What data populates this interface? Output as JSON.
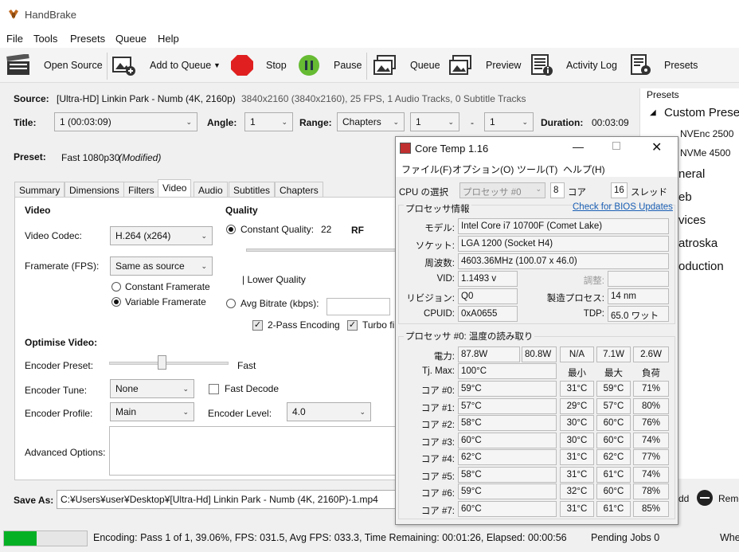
{
  "app": {
    "title": "HandBrake"
  },
  "menu": [
    "File",
    "Tools",
    "Presets",
    "Queue",
    "Help"
  ],
  "toolbar": {
    "open_source": "Open Source",
    "add_to_queue": "Add to Queue",
    "stop": "Stop",
    "pause": "Pause",
    "queue": "Queue",
    "preview": "Preview",
    "activity_log": "Activity Log",
    "presets": "Presets"
  },
  "source": {
    "label": "Source:",
    "name": "[Ultra-HD] Linkin Park - Numb (4K, 2160p)",
    "info": "3840x2160 (3840x2160), 25 FPS, 1 Audio Tracks, 0 Subtitle Tracks"
  },
  "title_row": {
    "title_label": "Title:",
    "title_value": "1 (00:03:09)",
    "angle_label": "Angle:",
    "angle_value": "1",
    "range_label": "Range:",
    "range_type": "Chapters",
    "range_start": "1",
    "range_sep": "-",
    "range_end": "1",
    "duration_label": "Duration:",
    "duration_value": "00:03:09"
  },
  "preset": {
    "label": "Preset:",
    "value": "Fast 1080p30",
    "modified": "(Modified)"
  },
  "tabs": [
    "Summary",
    "Dimensions",
    "Filters",
    "Video",
    "Audio",
    "Subtitles",
    "Chapters"
  ],
  "video": {
    "heading": "Video",
    "codec_label": "Video Codec:",
    "codec_value": "H.264 (x264)",
    "framerate_label": "Framerate (FPS):",
    "framerate_value": "Same as source",
    "constant_fr": "Constant Framerate",
    "variable_fr": "Variable Framerate"
  },
  "quality": {
    "heading": "Quality",
    "constant_quality": "Constant Quality:",
    "cq_value": "22",
    "rf": "RF",
    "lower_quality": "| Lower Quality",
    "avg_bitrate": "Avg Bitrate (kbps):",
    "two_pass": "2-Pass Encoding",
    "turbo": "Turbo fir"
  },
  "optimise": {
    "heading": "Optimise Video:",
    "preset_label": "Encoder Preset:",
    "preset_value": "Fast",
    "tune_label": "Encoder Tune:",
    "tune_value": "None",
    "fast_decode": "Fast Decode",
    "profile_label": "Encoder Profile:",
    "profile_value": "Main",
    "level_label": "Encoder Level:",
    "level_value": "4.0",
    "advanced_label": "Advanced Options:"
  },
  "save": {
    "label": "Save As:",
    "path": "C:¥Users¥user¥Desktop¥[Ultra-Hd] Linkin Park - Numb (4K, 2160P)-1.mp4",
    "add_partial": "dd",
    "remove_partial": "Remo"
  },
  "presets_panel": {
    "title": "Presets",
    "group": "Custom Preset",
    "items": [
      "NVEnc 2500",
      "NVMe 4500",
      "neral",
      "eb",
      "vices",
      "atroska",
      "oduction"
    ]
  },
  "status": {
    "progress": 0.3906,
    "text": "Encoding: Pass 1 of 1,  39.06%, FPS: 031.5,  Avg FPS: 033.3,  Time Remaining: 00:01:26,  Elapsed: 00:00:56",
    "pending": "Pending Jobs 0",
    "when": "Whe"
  },
  "coretemp": {
    "title": "Core Temp 1.16",
    "menu": [
      "ファイル(F)",
      "オプション(O)",
      "ツール(T)",
      "ヘルプ(H)"
    ],
    "cpu_select_label": "CPU の選択",
    "cpu_select_value": "プロセッサ #0",
    "cores_value": "8",
    "cores_label": "コア",
    "threads_value": "16",
    "threads_label": "スレッド",
    "proc_info_heading": "プロセッサ情報",
    "bios_link": "Check for BIOS Updates",
    "model_label": "モデル:",
    "model_value": "Intel Core i7 10700F (Comet Lake)",
    "socket_label": "ソケット:",
    "socket_value": "LGA 1200 (Socket H4)",
    "freq_label": "周波数:",
    "freq_value": "4603.36MHz (100.07 x 46.0)",
    "vid_label": "VID:",
    "vid_value": "1.1493 v",
    "adjust_label": "調整:",
    "rev_label": "リビジョン:",
    "rev_value": "Q0",
    "process_label": "製造プロセス:",
    "process_value": "14 nm",
    "cpuid_label": "CPUID:",
    "cpuid_value": "0xA0655",
    "tdp_label": "TDP:",
    "tdp_value": "65.0 ワット",
    "temp_heading": "プロセッサ #0: 温度の読み取り",
    "power_label": "電力:",
    "power_values": [
      "87.8W",
      "80.8W",
      "N/A",
      "7.1W",
      "2.6W"
    ],
    "tjmax_label": "Tj. Max:",
    "tjmax_value": "100°C",
    "col_min": "最小",
    "col_max": "最大",
    "col_load": "負荷",
    "cores": [
      {
        "label": "コア #0:",
        "temp": "59°C",
        "min": "31°C",
        "max": "59°C",
        "load": "71%"
      },
      {
        "label": "コア #1:",
        "temp": "57°C",
        "min": "29°C",
        "max": "57°C",
        "load": "80%"
      },
      {
        "label": "コア #2:",
        "temp": "58°C",
        "min": "30°C",
        "max": "60°C",
        "load": "76%"
      },
      {
        "label": "コア #3:",
        "temp": "60°C",
        "min": "30°C",
        "max": "60°C",
        "load": "74%"
      },
      {
        "label": "コア #4:",
        "temp": "62°C",
        "min": "31°C",
        "max": "62°C",
        "load": "77%"
      },
      {
        "label": "コア #5:",
        "temp": "58°C",
        "min": "31°C",
        "max": "61°C",
        "load": "74%"
      },
      {
        "label": "コア #6:",
        "temp": "59°C",
        "min": "32°C",
        "max": "60°C",
        "load": "78%"
      },
      {
        "label": "コア #7:",
        "temp": "60°C",
        "min": "31°C",
        "max": "61°C",
        "load": "85%"
      }
    ]
  },
  "colors": {
    "progress": "#06b025",
    "stop": "#e02020",
    "pause": "#66bb33",
    "link": "#1a5fb4"
  }
}
